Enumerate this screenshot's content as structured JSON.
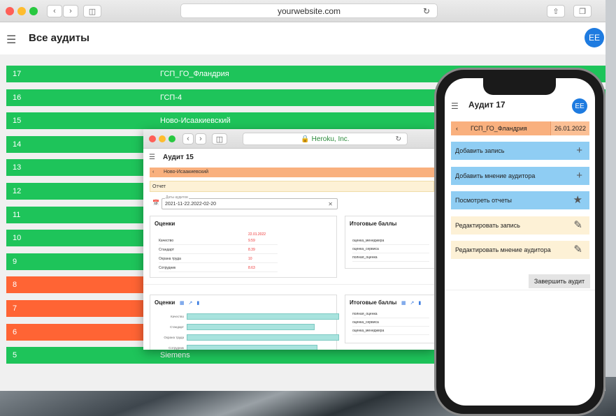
{
  "browser": {
    "url": "yourwebsite.com",
    "page_title": "Все аудиты",
    "avatar": "EE",
    "rows": [
      {
        "num": "17",
        "name": "ГСП_ГО_Фландрия",
        "status": "green"
      },
      {
        "num": "16",
        "name": "ГСП-4",
        "status": "green"
      },
      {
        "num": "15",
        "name": "Ново-Исаакиевский",
        "status": "green"
      },
      {
        "num": "14",
        "name": "",
        "status": "green"
      },
      {
        "num": "13",
        "name": "",
        "status": "green"
      },
      {
        "num": "12",
        "name": "",
        "status": "green"
      },
      {
        "num": "11",
        "name": "",
        "status": "green"
      },
      {
        "num": "10",
        "name": "",
        "status": "green"
      },
      {
        "num": "9",
        "name": "",
        "status": "green"
      },
      {
        "num": "8",
        "name": "",
        "status": "orange"
      },
      {
        "num": "7",
        "name": "",
        "status": "orange"
      },
      {
        "num": "6",
        "name": "",
        "status": "orange"
      },
      {
        "num": "5",
        "name": "Siemens",
        "status": "green"
      }
    ]
  },
  "overlay": {
    "url": "Heroku, Inc.",
    "title": "Аудит 15",
    "crumb": "Ново-Исаакиевский",
    "report": "Отчет",
    "date_label": "Даты аудитов",
    "date_value": "2021-11-22.2022-02-20",
    "scores_title": "Оценки",
    "scores_date": "22.01.2022",
    "scores": [
      {
        "label": "Качество",
        "value": "9.59"
      },
      {
        "label": "Стандарт",
        "value": "8.39"
      },
      {
        "label": "Охрана труда",
        "value": "10"
      },
      {
        "label": "Сотрудник",
        "value": "8.63"
      }
    ],
    "totals_title": "Итоговые баллы",
    "totals": [
      "оценка_менеджера",
      "оценка_сервиса",
      "полная_оценка"
    ],
    "chart_title": "Оценки",
    "chart_labels": [
      "Качество",
      "Стандарт",
      "Охрана труда",
      "Сотрудник"
    ],
    "chart_values": [
      1.0,
      0.84,
      1.0,
      0.86
    ],
    "totals2_title": "Итоговые баллы",
    "totals2": [
      "полная_оценка",
      "оценка_сервиса",
      "оценка_менеджера"
    ]
  },
  "phone": {
    "title": "Аудит 17",
    "avatar": "EE",
    "crumb": "ГСП_ГО_Фландрия",
    "date": "26.01.2022",
    "actions": [
      {
        "label": "Добавить запись",
        "icon": "plus-icon",
        "style": "blue"
      },
      {
        "label": "Добавить мнение аудитора",
        "icon": "plus-icon",
        "style": "blue"
      },
      {
        "label": "Посмотреть отчеты",
        "icon": "star-icon",
        "style": "blue"
      },
      {
        "label": "Редактировать запись",
        "icon": "pencil-icon",
        "style": "cream"
      },
      {
        "label": "Редактировать мнение аудитора",
        "icon": "pencil-icon",
        "style": "cream"
      }
    ],
    "finish": "Завершить аудит"
  },
  "colors": {
    "green": "#1ec45a",
    "orange": "#ff6434",
    "accent": "#1e7be0",
    "crumb": "#f9b07e",
    "blue_button": "#8fcdf3",
    "cream_button": "#fdf1d6"
  }
}
